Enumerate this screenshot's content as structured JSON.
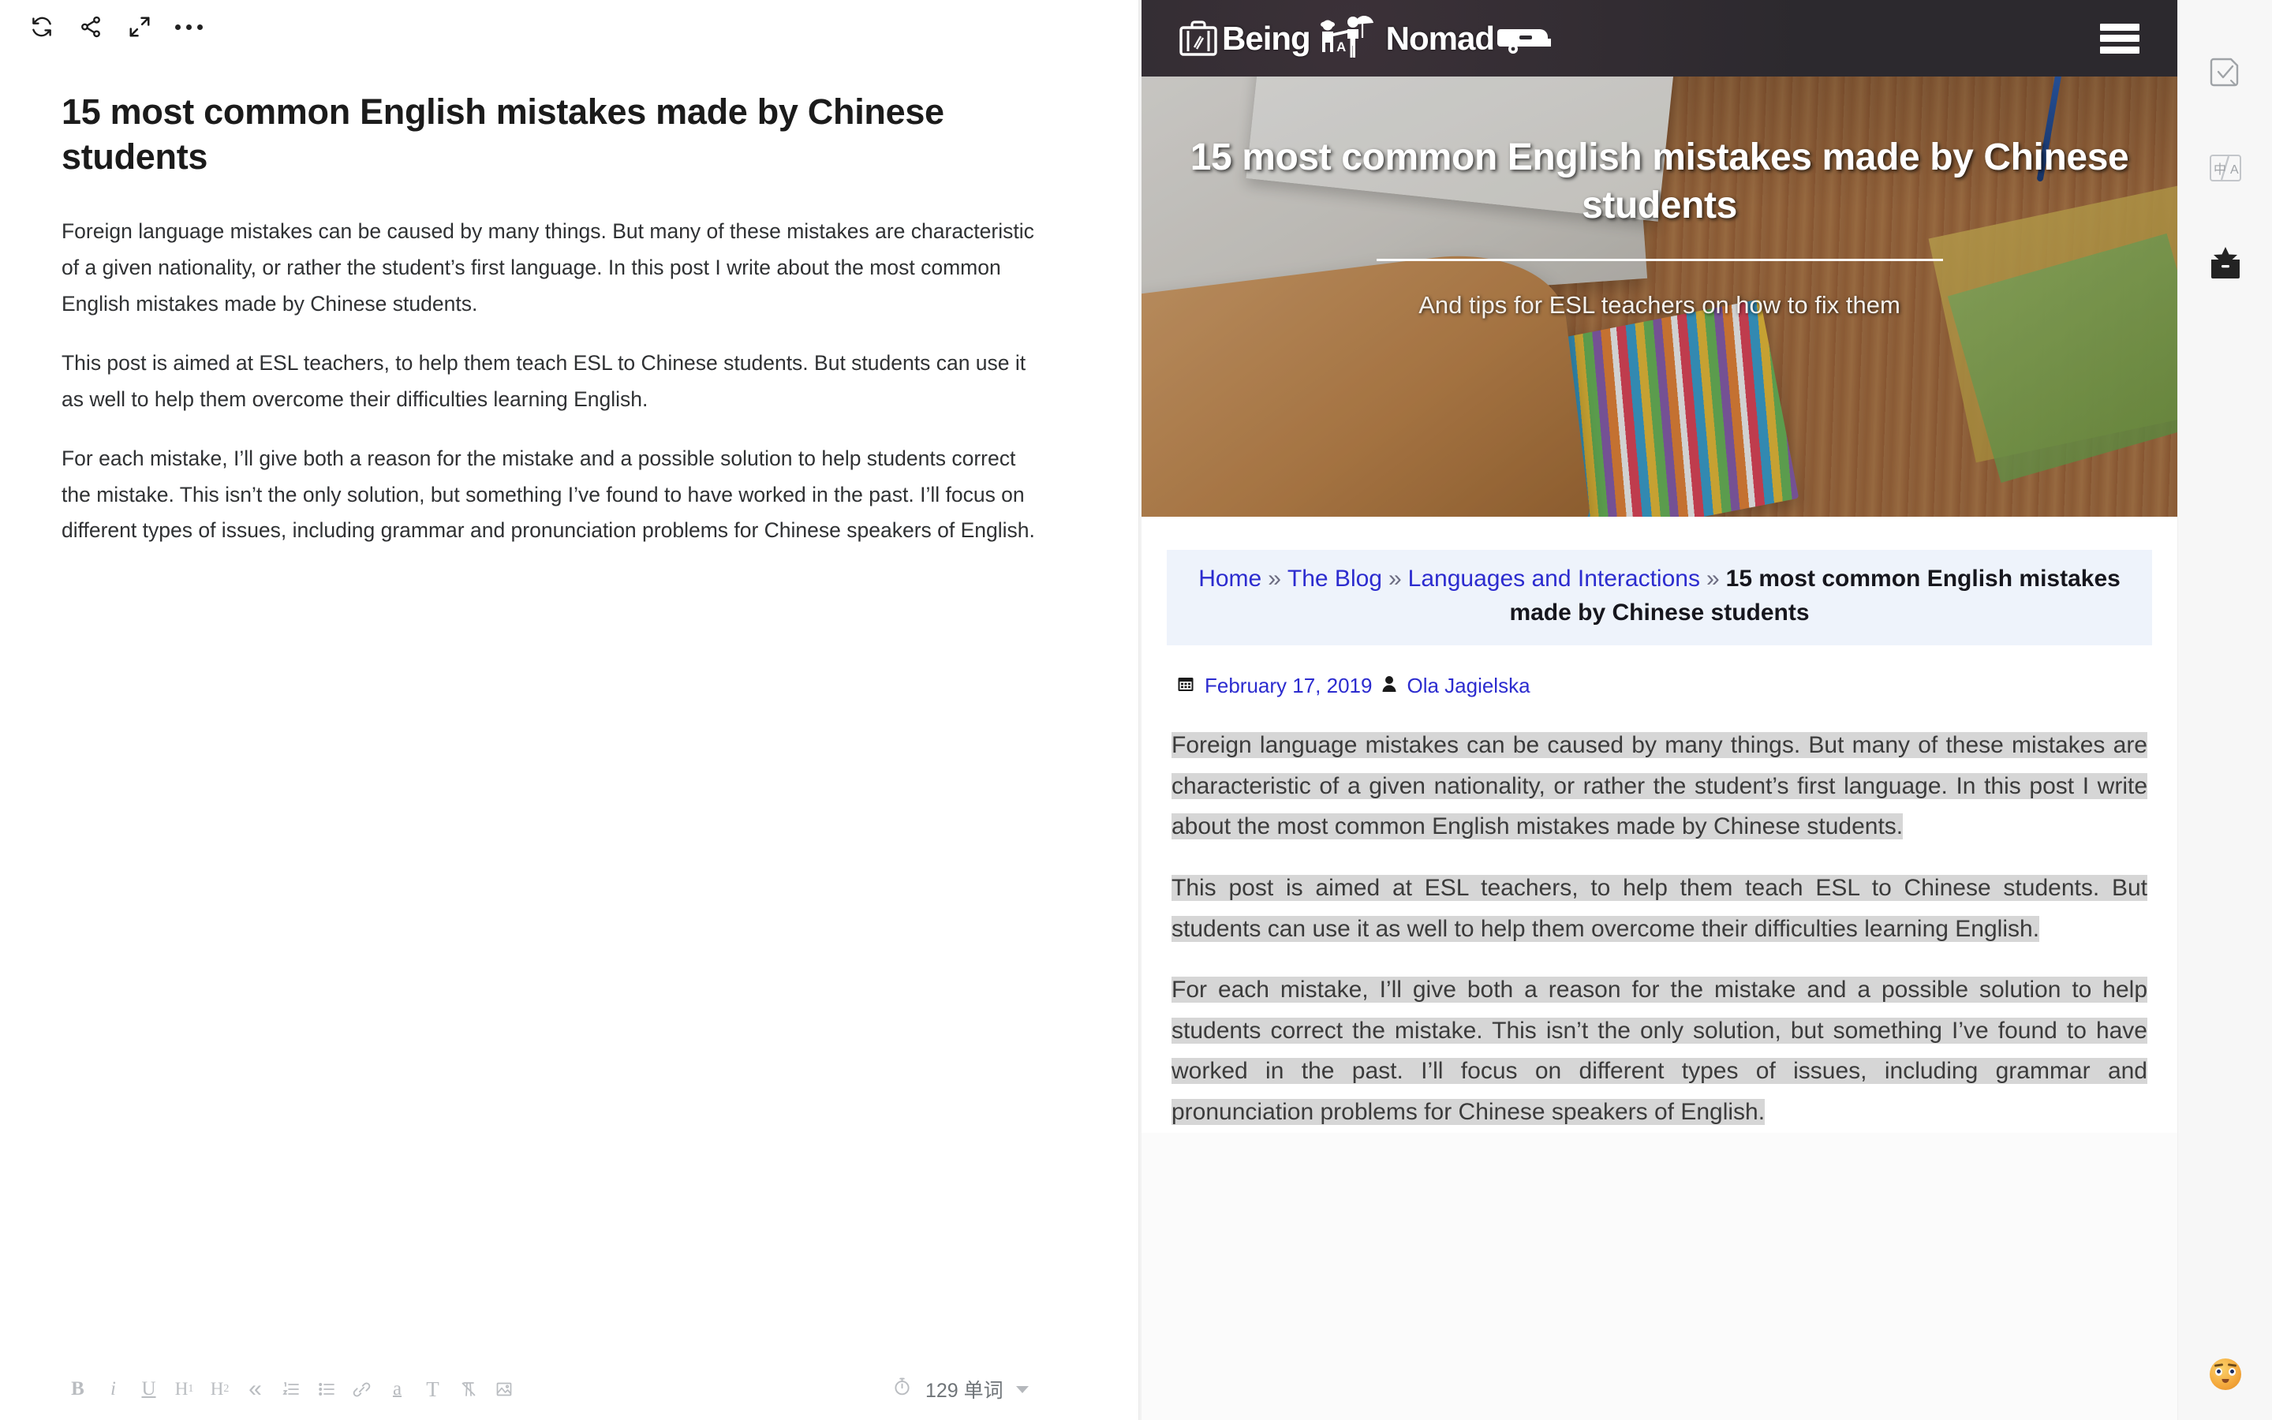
{
  "editor": {
    "toolbar": {
      "sync_label": "sync-icon",
      "share_label": "share-icon",
      "expand_label": "expand-icon",
      "more_label": "more-options-icon"
    },
    "title": "15 most common English mistakes made by Chinese students",
    "paragraphs": [
      "Foreign language mistakes can be caused by many things. But many of these mistakes are characteristic of a given nationality, or rather the student’s first language. In this post I write about the most common English mistakes made by Chinese students.",
      "This post is aimed at ESL teachers, to help them teach ESL to Chinese students. But students can use it as well to help them overcome their difficulties learning English.",
      "For each mistake, I’ll give both a reason for the mistake and a possible solution to help students correct the mistake. This isn’t the only solution, but something I’ve found to have worked in the past. I’ll focus on different types of issues, including grammar and pronunciation problems for Chinese speakers of English."
    ],
    "format_tools": [
      {
        "name": "bold-button",
        "label": "B"
      },
      {
        "name": "italic-button",
        "label": "i"
      },
      {
        "name": "underline-button",
        "label": "U"
      },
      {
        "name": "heading1-button",
        "label": "H"
      },
      {
        "name": "heading2-button",
        "label": "H"
      },
      {
        "name": "blockquote-button",
        "label": "«"
      },
      {
        "name": "ordered-list-button",
        "label": "ordered-list-icon"
      },
      {
        "name": "bulleted-list-button",
        "label": "bulleted-list-icon"
      },
      {
        "name": "link-button",
        "label": "link-icon"
      },
      {
        "name": "highlight-button",
        "label": "a"
      },
      {
        "name": "text-style-button",
        "label": "T"
      },
      {
        "name": "clear-format-button",
        "label": "clear-format-icon"
      },
      {
        "name": "insert-image-button",
        "label": "image-icon"
      }
    ],
    "heading1_sub": "1",
    "heading2_sub": "2",
    "word_count": "129 单词",
    "timer_icon": "stopwatch-icon"
  },
  "preview": {
    "site": {
      "logo_text_1": "Being",
      "logo_text_2": "Nomad",
      "logo_middle_letter": "A",
      "menu_label": "hamburger-menu-icon"
    },
    "hero": {
      "title": "15 most common English mistakes made by Chinese students",
      "subtitle": "And tips for ESL teachers on how to fix them"
    },
    "breadcrumb": {
      "items": [
        {
          "label": "Home",
          "link": true
        },
        {
          "label": "The Blog",
          "link": true
        },
        {
          "label": "Languages and Interactions",
          "link": true
        }
      ],
      "separator": "»",
      "current": "15 most common English mistakes made by Chinese students"
    },
    "meta": {
      "calendar_icon": "calendar-icon",
      "date": "February 17, 2019",
      "author_icon": "user-icon",
      "author": "Ola Jagielska"
    },
    "post_paragraphs": [
      "Foreign language mistakes can be caused by many things. But many of these mistakes are characteristic of a given nationality, or rather the student’s first language. In this post I write about the most common English mistakes made by Chinese students.",
      "This post is aimed at ESL teachers, to help them teach ESL to Chinese students. But students can use it as well to help them overcome their difficulties learning English.",
      "For each mistake, I’ll give both a reason for the mistake and a possible solution to help students correct the mistake. This isn’t the only solution, but something I’ve found to have worked in the past. I’ll focus on different types of issues, including grammar and pronunciation problems for Chinese speakers of English."
    ]
  },
  "right_rail": {
    "buttons": [
      {
        "name": "proofread-button",
        "icon": "document-check-icon"
      },
      {
        "name": "translate-button",
        "icon": "translate-icon"
      },
      {
        "name": "archive-button",
        "icon": "archive-box-icon"
      }
    ],
    "assistant_badge": "emoji-face-icon"
  },
  "colors": {
    "link": "#2c2ccf",
    "selection": "#d6d6d6",
    "breadcrumb_bg": "#eef3fb",
    "header_bg": "#2e2b30"
  }
}
